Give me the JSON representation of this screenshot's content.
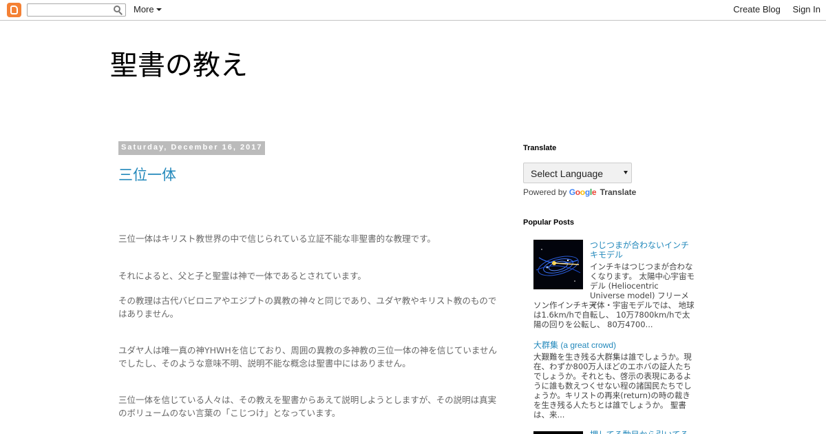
{
  "navbar": {
    "more_label": "More",
    "create_blog": "Create Blog",
    "sign_in": "Sign In",
    "search_placeholder": ""
  },
  "blog": {
    "title": "聖書の教え"
  },
  "post": {
    "date": "Saturday, December 16, 2017",
    "title": "三位一体",
    "paragraphs": [
      "三位一体はキリスト教世界の中で信じられている立証不能な非聖書的な教理です。",
      "それによると、父と子と聖霊は神で一体であるとされています。",
      "その教理は古代バビロニアやエジプトの異教の神々と同じであり、ユダヤ教やキリスト教のものではありません。",
      "ユダヤ人は唯一真の神YHWHを信じており、周囲の異教の多神教の三位一体の神を信じていませんでしたし、そのような意味不明、説明不能な概念は聖書中にはありません。",
      "三位一体を信じている人々は、その教えを聖書からあえて説明しようとしますが、その説明は真実のボリュームのない言葉の「こじつけ」となっています。"
    ]
  },
  "sidebar": {
    "translate": {
      "title": "Translate",
      "select_label": "Select Language",
      "powered_by": "Powered by",
      "google": "Google",
      "translate_word": "Translate"
    },
    "popular": {
      "title": "Popular Posts",
      "posts": [
        {
          "title": "つじつまが合わないインチキモデル",
          "snippet_top": "インチキはつじつまが合わなくなります。 太陽中心宇宙モデル (Heliocentric Universe model) フリーメイ",
          "snippet_bottom": "ソン作インチキ天体・宇宙モデルでは、 地球は1.6km/hで自転し、 10万7800km/hで太陽の回りを公転し、 80万4700..."
        },
        {
          "title": "大群集 (a great crowd)",
          "snippet": "大艱難を生き残る大群集は誰でしょうか。現在、わずか800万人ほどのエホバの証人たちでしょうか。それとも、啓示の表現にあるように誰も数えつくせない程の諸国民たちでしょうか。キリストの再来(return)の時の裁きを生き残る人たちとは誰でしょうか。 聖書は、来..."
        },
        {
          "title": "押してる動目から引いてる"
        }
      ]
    }
  },
  "colors": {
    "link": "#2288bb",
    "date_bg": "#bbbbbb",
    "blogger_orange": "#f48135"
  }
}
